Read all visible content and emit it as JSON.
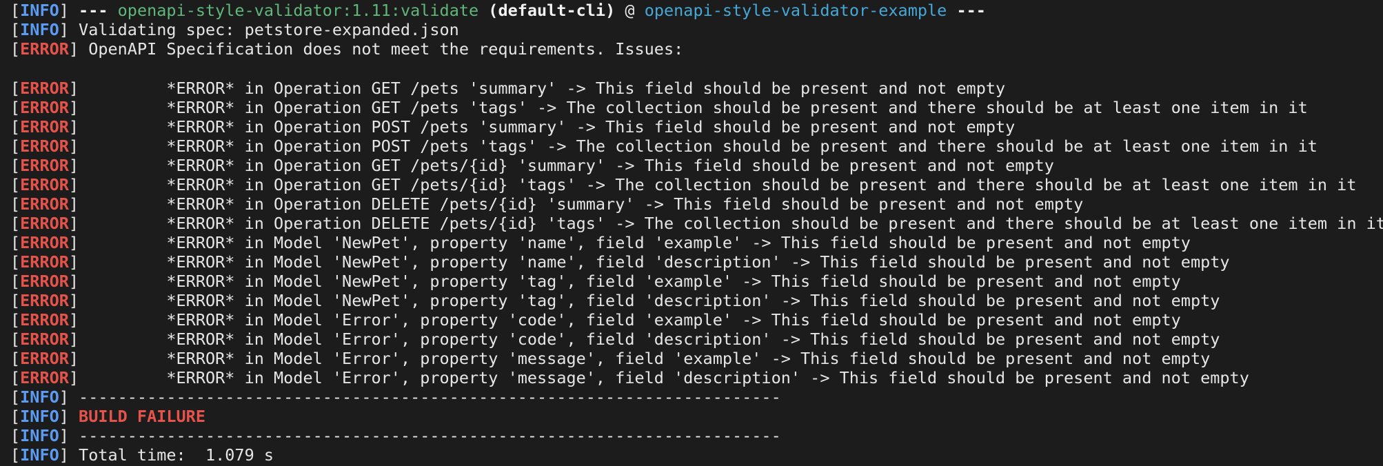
{
  "colors": {
    "background": "#1c1c1c",
    "text": "#e6e6e6",
    "info": "#5b9bf2",
    "error": "#e5534b",
    "plugin": "#5fb87a",
    "project": "#45a8d6"
  },
  "header": {
    "level": "INFO",
    "dashes_left": "---",
    "plugin": "openapi-style-validator:1.11:validate",
    "execution": "(default-cli)",
    "at": "@",
    "project": "openapi-style-validator-example",
    "dashes_right": "---"
  },
  "validating": {
    "level": "INFO",
    "text": "Validating spec: petstore-expanded.json"
  },
  "summary_error": {
    "level": "ERROR",
    "text": "OpenAPI Specification does not meet the requirements. Issues:"
  },
  "issues": [
    {
      "level": "ERROR",
      "text": "        *ERROR* in Operation GET /pets 'summary' -> This field should be present and not empty"
    },
    {
      "level": "ERROR",
      "text": "        *ERROR* in Operation GET /pets 'tags' -> The collection should be present and there should be at least one item in it"
    },
    {
      "level": "ERROR",
      "text": "        *ERROR* in Operation POST /pets 'summary' -> This field should be present and not empty"
    },
    {
      "level": "ERROR",
      "text": "        *ERROR* in Operation POST /pets 'tags' -> The collection should be present and there should be at least one item in it"
    },
    {
      "level": "ERROR",
      "text": "        *ERROR* in Operation GET /pets/{id} 'summary' -> This field should be present and not empty"
    },
    {
      "level": "ERROR",
      "text": "        *ERROR* in Operation GET /pets/{id} 'tags' -> The collection should be present and there should be at least one item in it"
    },
    {
      "level": "ERROR",
      "text": "        *ERROR* in Operation DELETE /pets/{id} 'summary' -> This field should be present and not empty"
    },
    {
      "level": "ERROR",
      "text": "        *ERROR* in Operation DELETE /pets/{id} 'tags' -> The collection should be present and there should be at least one item in it"
    },
    {
      "level": "ERROR",
      "text": "        *ERROR* in Model 'NewPet', property 'name', field 'example' -> This field should be present and not empty"
    },
    {
      "level": "ERROR",
      "text": "        *ERROR* in Model 'NewPet', property 'name', field 'description' -> This field should be present and not empty"
    },
    {
      "level": "ERROR",
      "text": "        *ERROR* in Model 'NewPet', property 'tag', field 'example' -> This field should be present and not empty"
    },
    {
      "level": "ERROR",
      "text": "        *ERROR* in Model 'NewPet', property 'tag', field 'description' -> This field should be present and not empty"
    },
    {
      "level": "ERROR",
      "text": "        *ERROR* in Model 'Error', property 'code', field 'example' -> This field should be present and not empty"
    },
    {
      "level": "ERROR",
      "text": "        *ERROR* in Model 'Error', property 'code', field 'description' -> This field should be present and not empty"
    },
    {
      "level": "ERROR",
      "text": "        *ERROR* in Model 'Error', property 'message', field 'example' -> This field should be present and not empty"
    },
    {
      "level": "ERROR",
      "text": "        *ERROR* in Model 'Error', property 'message', field 'description' -> This field should be present and not empty"
    }
  ],
  "separator_1": {
    "level": "INFO",
    "text": "------------------------------------------------------------------------"
  },
  "build_result": {
    "level": "INFO",
    "text": "BUILD FAILURE"
  },
  "separator_2": {
    "level": "INFO",
    "text": "------------------------------------------------------------------------"
  },
  "total_time": {
    "level": "INFO",
    "text": "Total time:  1.079 s"
  }
}
